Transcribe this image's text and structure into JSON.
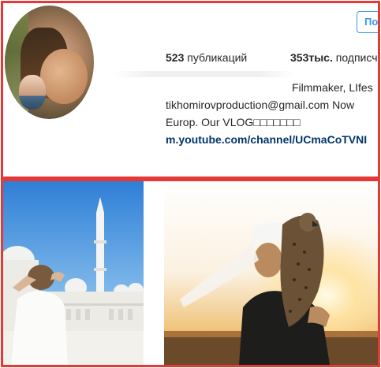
{
  "profile": {
    "follow_label": "По",
    "stats": {
      "posts_count": "523",
      "posts_label": "публикаций",
      "followers_count": "353тыс.",
      "followers_label": "подписч"
    },
    "bio": {
      "line1": "Filmmaker, LIfes",
      "line2": "tikhomirovproduction@gmail.com Now",
      "line3": "Europ. Our VLOG□□□□□□□",
      "link": "m.youtube.com/channel/UCmaCoTVNI"
    }
  },
  "posts": [
    {
      "subject": "woman-in-white-before-mosque"
    },
    {
      "subject": "man-in-turban-with-falcon-at-sunset"
    }
  ],
  "colors": {
    "highlight_border": "#e53935",
    "link_text": "#003569",
    "follow_button": "#3897f0"
  }
}
